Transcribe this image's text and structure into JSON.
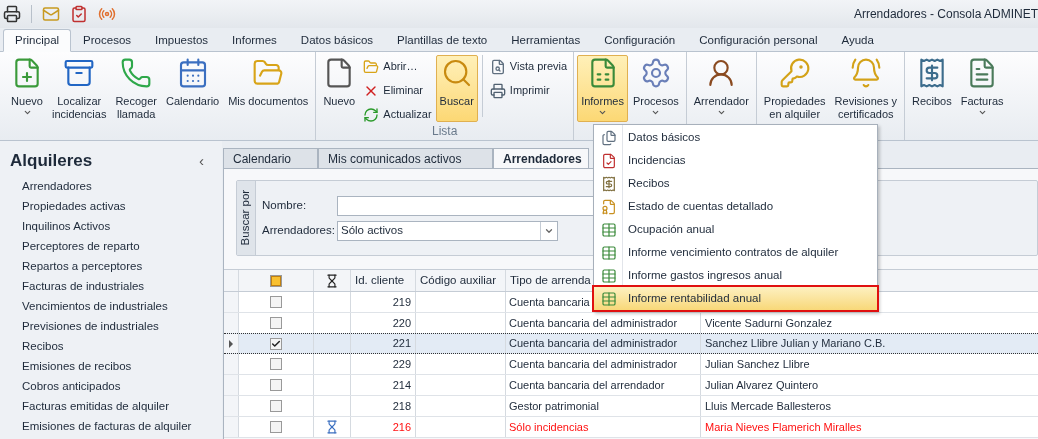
{
  "title_bar": {
    "title": "Arrendadores - Consola ADMINET"
  },
  "ribbon_tabs": [
    {
      "label": "Principal",
      "selected": true
    },
    {
      "label": "Procesos",
      "selected": false
    },
    {
      "label": "Impuestos",
      "selected": false
    },
    {
      "label": "Informes",
      "selected": false
    },
    {
      "label": "Datos básicos",
      "selected": false
    },
    {
      "label": "Plantillas de texto",
      "selected": false
    },
    {
      "label": "Herramientas",
      "selected": false
    },
    {
      "label": "Configuración",
      "selected": false
    },
    {
      "label": "Configuración personal",
      "selected": false
    },
    {
      "label": "Ayuda",
      "selected": false
    }
  ],
  "ribbon_groups": [
    {
      "items": [
        {
          "kind": "large",
          "lines": [
            "Nuevo"
          ],
          "dropdown": true,
          "highlighted": false
        },
        {
          "kind": "large",
          "lines": [
            "Localizar",
            "incidencias"
          ],
          "dropdown": false,
          "highlighted": false
        },
        {
          "kind": "large",
          "lines": [
            "Recoger",
            "llamada"
          ],
          "dropdown": false,
          "highlighted": false
        },
        {
          "kind": "large",
          "lines": [
            "Calendario"
          ],
          "dropdown": false,
          "highlighted": false
        },
        {
          "kind": "large",
          "lines": [
            "Mis documentos"
          ],
          "dropdown": false,
          "highlighted": false
        }
      ]
    },
    {
      "label": "Lista",
      "items": [
        {
          "kind": "large",
          "lines": [
            "Nuevo"
          ],
          "dropdown": false,
          "highlighted": false
        },
        {
          "kind": "stack",
          "buttons": [
            "Abrir…",
            "Eliminar",
            "Actualizar"
          ]
        },
        {
          "kind": "large",
          "lines": [
            "Buscar"
          ],
          "dropdown": false,
          "highlighted": true
        },
        {
          "kind": "divider"
        },
        {
          "kind": "stack",
          "buttons": [
            "Vista previa",
            "Imprimir"
          ]
        }
      ]
    },
    {
      "items": [
        {
          "kind": "large",
          "lines": [
            "Informes"
          ],
          "dropdown": true,
          "highlighted": true
        },
        {
          "kind": "large",
          "lines": [
            "Procesos"
          ],
          "dropdown": true,
          "highlighted": false
        }
      ]
    },
    {
      "items": [
        {
          "kind": "large",
          "lines": [
            "Arrendador"
          ],
          "dropdown": true,
          "highlighted": false
        }
      ]
    },
    {
      "items": [
        {
          "kind": "large",
          "lines": [
            "Propiedades",
            "en alquiler"
          ],
          "dropdown": false,
          "highlighted": false
        },
        {
          "kind": "large",
          "lines": [
            "Revisiones y",
            "certificados"
          ],
          "dropdown": false,
          "highlighted": false
        }
      ]
    },
    {
      "items": [
        {
          "kind": "large",
          "lines": [
            "Recibos"
          ],
          "dropdown": false,
          "highlighted": false
        },
        {
          "kind": "large",
          "lines": [
            "Facturas"
          ],
          "dropdown": true,
          "highlighted": false
        }
      ]
    }
  ],
  "sidebar": {
    "title": "Alquileres",
    "collapse_glyph": "‹",
    "items": [
      "Arrendadores",
      "Propiedades activas",
      "Inquilinos Activos",
      "Perceptores de reparto",
      "Repartos a perceptores",
      "Facturas de industriales",
      "Vencimientos de industriales",
      "Previsiones de industriales",
      "Recibos",
      "Emisiones de recibos",
      "Cobros anticipados",
      "Facturas emitidas de alquiler",
      "Emisiones de facturas de alquiler"
    ]
  },
  "document_tabs": [
    {
      "label": "Calendario",
      "selected": false
    },
    {
      "label": "Mis comunicados activos",
      "selected": false
    },
    {
      "label": "Arrendadores",
      "selected": true
    }
  ],
  "search": {
    "side_label": "Buscar por",
    "fields": [
      {
        "kind": "text",
        "label": "Nombre:"
      },
      {
        "kind": "select",
        "label": "Arrendadores:",
        "value": "Sólo activos"
      }
    ]
  },
  "grid": {
    "header_checkbox": {
      "partially_checked": true
    },
    "columns": [
      "Id. cliente",
      "Código auxiliar",
      "Tipo de arrenda"
    ],
    "rows": [
      {
        "id": "219",
        "tipo": "Cuenta bancaria",
        "checked": false,
        "pending": false,
        "selected": false
      },
      {
        "id": "220",
        "tipo": "Cuenta bancaria del administrador",
        "name": "Vicente Sadurni Gonzalez",
        "checked": false,
        "pending": false,
        "selected": false
      },
      {
        "id": "221",
        "tipo": "Cuenta bancaria del administrador",
        "name": "Sanchez Llibre Julian y Mariano C.B.",
        "checked": true,
        "pending": false,
        "selected": true
      },
      {
        "id": "229",
        "tipo": "Cuenta bancaria del administrador",
        "name": "Julian Sanchez Llibre",
        "checked": false,
        "pending": false,
        "selected": false
      },
      {
        "id": "214",
        "tipo": "Cuenta bancaria del arrendador",
        "name": "Julian Alvarez Quintero",
        "checked": false,
        "pending": false,
        "selected": false
      },
      {
        "id": "218",
        "tipo": "Gestor patrimonial",
        "name": "Lluis Mercade Ballesteros",
        "checked": false,
        "pending": false,
        "selected": false
      },
      {
        "id": "216",
        "tipo": "Sólo incidencias",
        "name": "Maria Nieves Flamerich Miralles",
        "checked": false,
        "pending": true,
        "selected": false
      }
    ]
  },
  "informes_menu": {
    "items": [
      {
        "label": "Datos básicos",
        "selected": false
      },
      {
        "label": "Incidencias",
        "selected": false
      },
      {
        "label": "Recibos",
        "selected": false
      },
      {
        "label": "Estado de cuentas detallado",
        "selected": false
      },
      {
        "label": "Ocupación anual",
        "selected": false
      },
      {
        "label": "Informe vencimiento contratos de alquiler",
        "selected": false
      },
      {
        "label": "Informe gastos ingresos anual",
        "selected": false
      },
      {
        "label": "Informe rentabilidad anual",
        "selected": true
      }
    ]
  }
}
